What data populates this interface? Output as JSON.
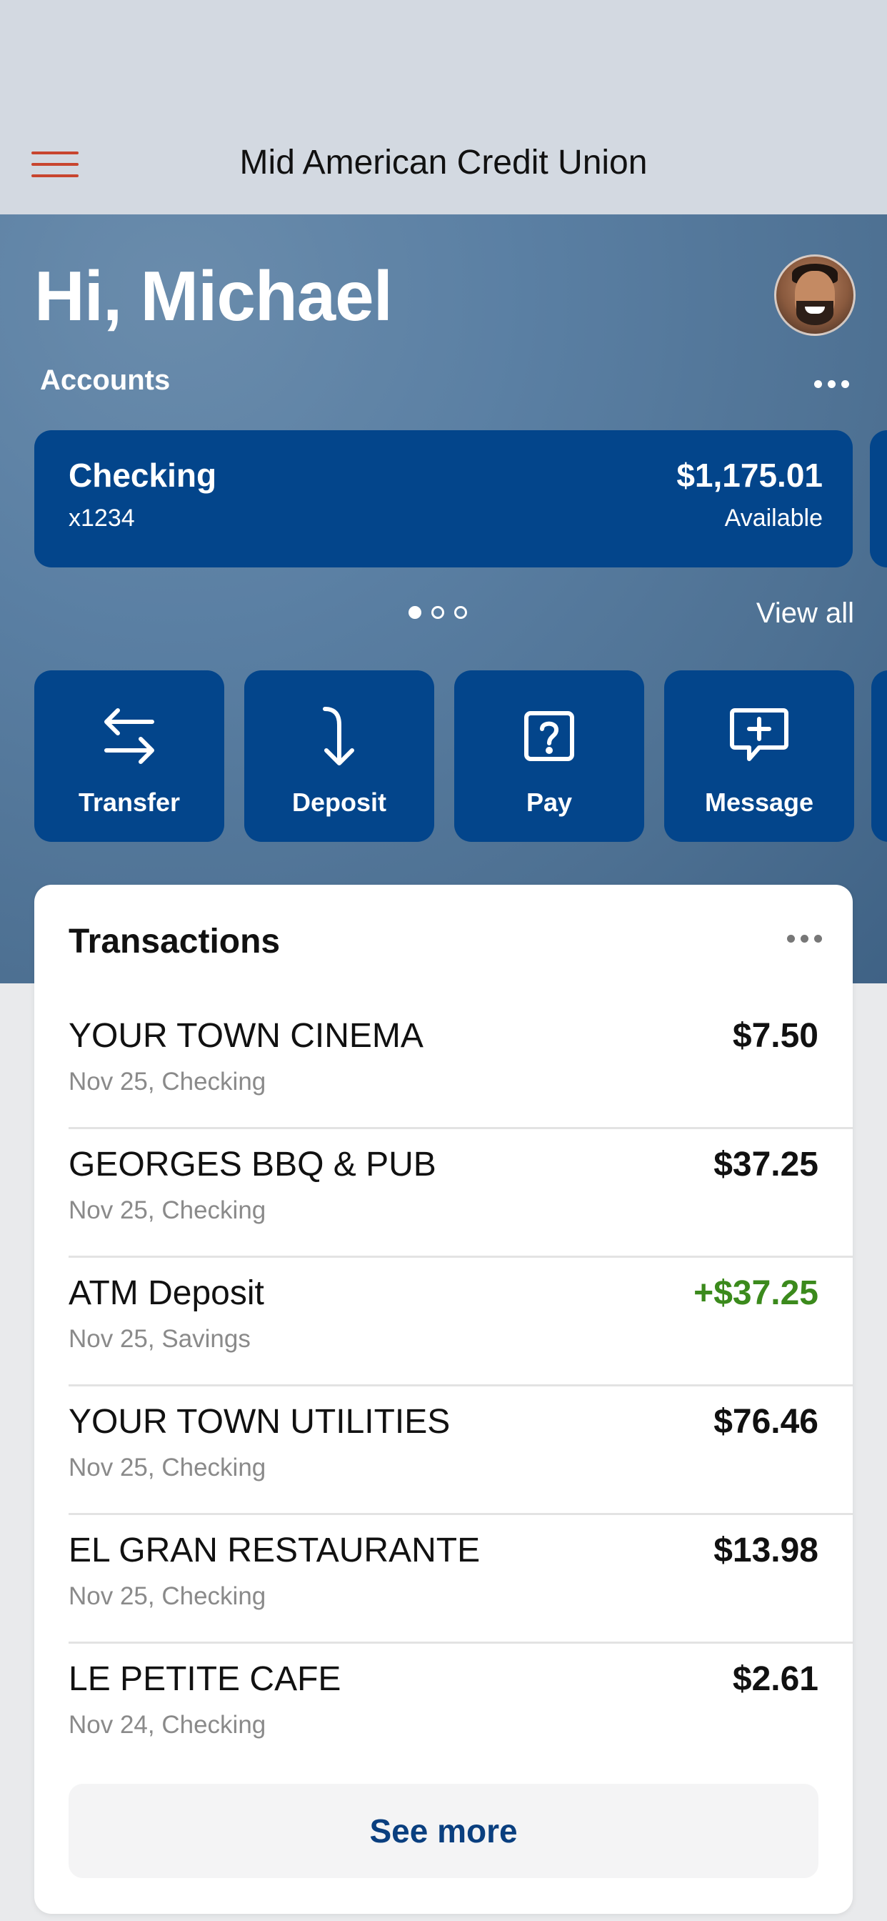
{
  "header": {
    "title": "Mid American Credit Union"
  },
  "greeting": "Hi, Michael",
  "accounts": {
    "label": "Accounts",
    "card": {
      "name": "Checking",
      "number": "x1234",
      "balance": "$1,175.01",
      "balance_label": "Available"
    },
    "pager": {
      "count": 3,
      "active": 1
    },
    "view_all": "View all"
  },
  "actions": [
    {
      "label": "Transfer",
      "icon": "transfer-arrows-icon"
    },
    {
      "label": "Deposit",
      "icon": "deposit-arrow-icon"
    },
    {
      "label": "Pay",
      "icon": "pay-question-icon"
    },
    {
      "label": "Message",
      "icon": "message-plus-icon"
    }
  ],
  "transactions": {
    "title": "Transactions",
    "items": [
      {
        "merchant": "YOUR TOWN CINEMA",
        "meta": "Nov 25, Checking",
        "amount": "$7.50"
      },
      {
        "merchant": "GEORGES BBQ & PUB",
        "meta": "Nov 25, Checking",
        "amount": "$37.25"
      },
      {
        "merchant": "ATM Deposit",
        "meta": "Nov 25, Savings",
        "amount": "+$37.25"
      },
      {
        "merchant": "YOUR TOWN UTILITIES",
        "meta": "Nov 25, Checking",
        "amount": "$76.46"
      },
      {
        "merchant": "EL GRAN RESTAURANTE",
        "meta": "Nov 25, Checking",
        "amount": "$13.98"
      },
      {
        "merchant": "LE PETITE CAFE",
        "meta": "Nov 24, Checking",
        "amount": "$2.61"
      }
    ],
    "see_more": "See more"
  },
  "colors": {
    "brand": "#03458b",
    "menu_accent": "#c8452e",
    "credit": "#3b8a1c"
  }
}
